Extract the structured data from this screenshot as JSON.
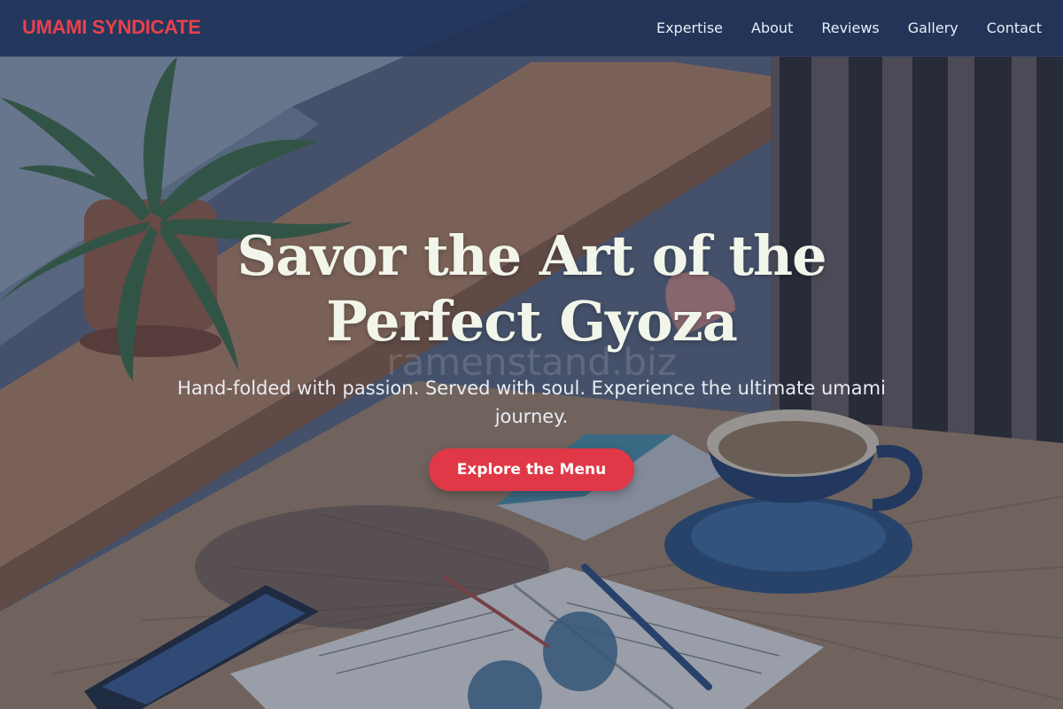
{
  "brand": {
    "name": "UMAMI SYNDICATE",
    "color": "#e8414d"
  },
  "nav": {
    "items": [
      {
        "label": "Expertise"
      },
      {
        "label": "About"
      },
      {
        "label": "Reviews"
      },
      {
        "label": "Gallery"
      },
      {
        "label": "Contact"
      }
    ]
  },
  "hero": {
    "title_line1": "Savor the Art of the",
    "title_line2": "Perfect Gyoza",
    "watermark": "ramenstand.biz",
    "subtitle": "Hand-folded with passion. Served with soul. Experience the ultimate umami journey.",
    "cta_label": "Explore the Menu",
    "cta_color": "#e03847",
    "background_image": "cafe-table-photo"
  }
}
